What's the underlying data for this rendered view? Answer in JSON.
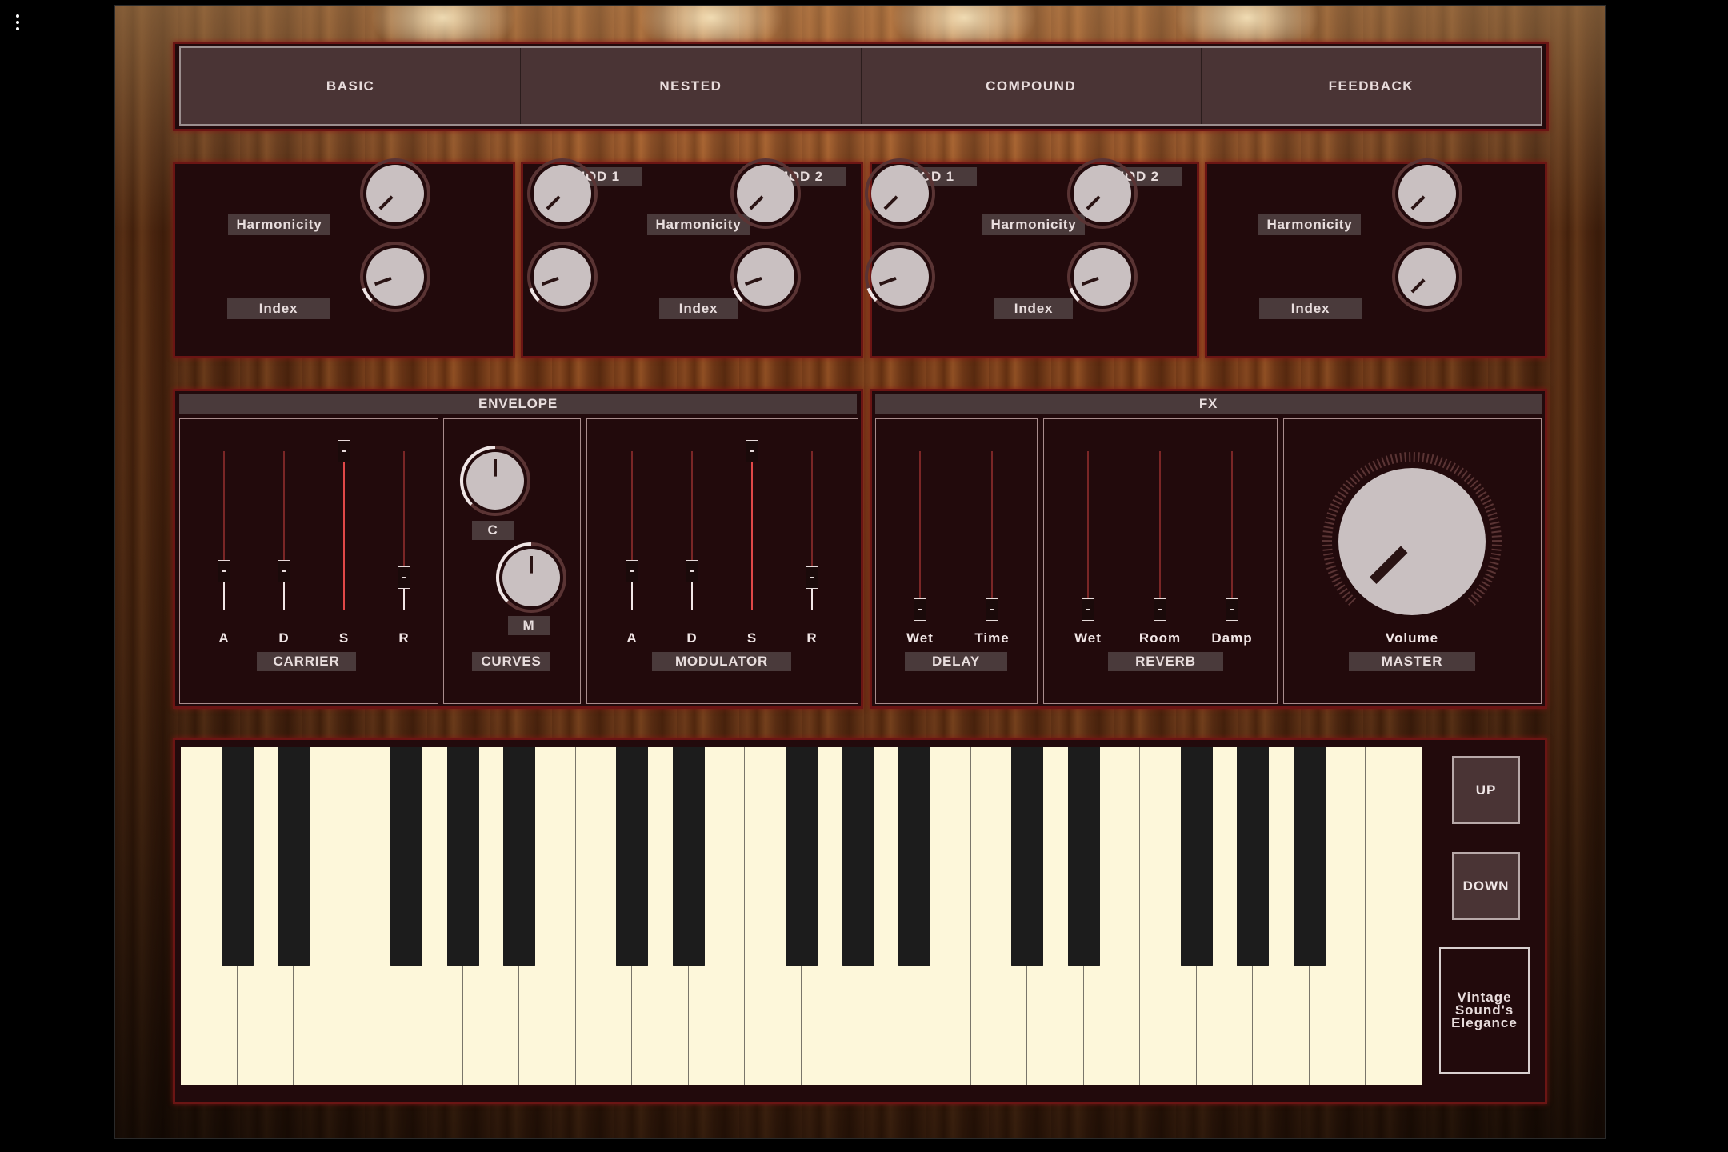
{
  "app": {
    "menu_icon": "vertical-dots-icon"
  },
  "tabs": [
    "BASIC",
    "NESTED",
    "COMPOUND",
    "FEEDBACK"
  ],
  "fm": {
    "basic": {
      "harmonicity": "Harmonicity",
      "index": "Index"
    },
    "nested": {
      "mod1": "MOD 1",
      "mod2": "MOD 2",
      "harmonicity": "Harmonicity",
      "index": "Index"
    },
    "compound": {
      "mod1": "MOD 1",
      "mod2": "MOD 2",
      "harmonicity": "Harmonicity",
      "index": "Index"
    },
    "feedback": {
      "harmonicity": "Harmonicity",
      "index": "Index"
    }
  },
  "envelope": {
    "title": "ENVELOPE",
    "carrier": {
      "title": "CARRIER",
      "sliders": [
        {
          "label": "A",
          "value": 0.24
        },
        {
          "label": "D",
          "value": 0.24
        },
        {
          "label": "S",
          "value": 1.0
        },
        {
          "label": "R",
          "value": 0.2
        }
      ]
    },
    "curves": {
      "title": "CURVES",
      "c_label": "C",
      "m_label": "M"
    },
    "modulator": {
      "title": "MODULATOR",
      "sliders": [
        {
          "label": "A",
          "value": 0.24
        },
        {
          "label": "D",
          "value": 0.24
        },
        {
          "label": "S",
          "value": 1.0
        },
        {
          "label": "R",
          "value": 0.2
        }
      ]
    }
  },
  "fx": {
    "title": "FX",
    "delay": {
      "title": "DELAY",
      "sliders": [
        {
          "label": "Wet",
          "value": 0
        },
        {
          "label": "Time",
          "value": 0
        }
      ]
    },
    "reverb": {
      "title": "REVERB",
      "sliders": [
        {
          "label": "Wet",
          "value": 0
        },
        {
          "label": "Room",
          "value": 0
        },
        {
          "label": "Damp",
          "value": 0
        }
      ]
    },
    "master": {
      "title": "MASTER",
      "volume_label": "Volume"
    }
  },
  "keyboard": {
    "white_keys": 22,
    "octave_up": "UP",
    "octave_down": "DOWN"
  },
  "brand": {
    "line1": "Vintage",
    "line2": "Sound's",
    "line3": "Elegance"
  },
  "colors": {
    "accent_red": "#e14848",
    "panel": "#220a0c",
    "key_white": "#fdf7da",
    "key_black": "#1c1c1c"
  }
}
